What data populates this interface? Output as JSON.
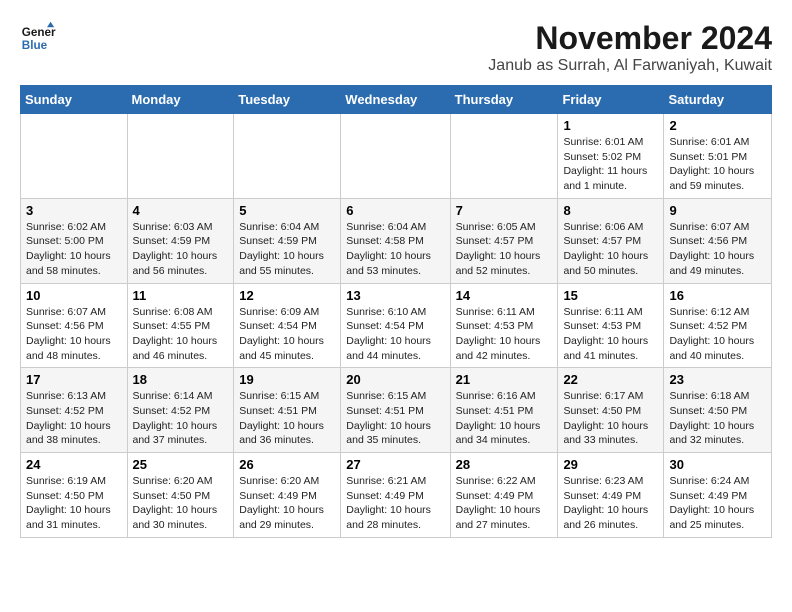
{
  "logo": {
    "line1": "General",
    "line2": "Blue"
  },
  "title": "November 2024",
  "location": "Janub as Surrah, Al Farwaniyah, Kuwait",
  "weekdays": [
    "Sunday",
    "Monday",
    "Tuesday",
    "Wednesday",
    "Thursday",
    "Friday",
    "Saturday"
  ],
  "weeks": [
    [
      {
        "day": "",
        "detail": ""
      },
      {
        "day": "",
        "detail": ""
      },
      {
        "day": "",
        "detail": ""
      },
      {
        "day": "",
        "detail": ""
      },
      {
        "day": "",
        "detail": ""
      },
      {
        "day": "1",
        "detail": "Sunrise: 6:01 AM\nSunset: 5:02 PM\nDaylight: 11 hours\nand 1 minute."
      },
      {
        "day": "2",
        "detail": "Sunrise: 6:01 AM\nSunset: 5:01 PM\nDaylight: 10 hours\nand 59 minutes."
      }
    ],
    [
      {
        "day": "3",
        "detail": "Sunrise: 6:02 AM\nSunset: 5:00 PM\nDaylight: 10 hours\nand 58 minutes."
      },
      {
        "day": "4",
        "detail": "Sunrise: 6:03 AM\nSunset: 4:59 PM\nDaylight: 10 hours\nand 56 minutes."
      },
      {
        "day": "5",
        "detail": "Sunrise: 6:04 AM\nSunset: 4:59 PM\nDaylight: 10 hours\nand 55 minutes."
      },
      {
        "day": "6",
        "detail": "Sunrise: 6:04 AM\nSunset: 4:58 PM\nDaylight: 10 hours\nand 53 minutes."
      },
      {
        "day": "7",
        "detail": "Sunrise: 6:05 AM\nSunset: 4:57 PM\nDaylight: 10 hours\nand 52 minutes."
      },
      {
        "day": "8",
        "detail": "Sunrise: 6:06 AM\nSunset: 4:57 PM\nDaylight: 10 hours\nand 50 minutes."
      },
      {
        "day": "9",
        "detail": "Sunrise: 6:07 AM\nSunset: 4:56 PM\nDaylight: 10 hours\nand 49 minutes."
      }
    ],
    [
      {
        "day": "10",
        "detail": "Sunrise: 6:07 AM\nSunset: 4:56 PM\nDaylight: 10 hours\nand 48 minutes."
      },
      {
        "day": "11",
        "detail": "Sunrise: 6:08 AM\nSunset: 4:55 PM\nDaylight: 10 hours\nand 46 minutes."
      },
      {
        "day": "12",
        "detail": "Sunrise: 6:09 AM\nSunset: 4:54 PM\nDaylight: 10 hours\nand 45 minutes."
      },
      {
        "day": "13",
        "detail": "Sunrise: 6:10 AM\nSunset: 4:54 PM\nDaylight: 10 hours\nand 44 minutes."
      },
      {
        "day": "14",
        "detail": "Sunrise: 6:11 AM\nSunset: 4:53 PM\nDaylight: 10 hours\nand 42 minutes."
      },
      {
        "day": "15",
        "detail": "Sunrise: 6:11 AM\nSunset: 4:53 PM\nDaylight: 10 hours\nand 41 minutes."
      },
      {
        "day": "16",
        "detail": "Sunrise: 6:12 AM\nSunset: 4:52 PM\nDaylight: 10 hours\nand 40 minutes."
      }
    ],
    [
      {
        "day": "17",
        "detail": "Sunrise: 6:13 AM\nSunset: 4:52 PM\nDaylight: 10 hours\nand 38 minutes."
      },
      {
        "day": "18",
        "detail": "Sunrise: 6:14 AM\nSunset: 4:52 PM\nDaylight: 10 hours\nand 37 minutes."
      },
      {
        "day": "19",
        "detail": "Sunrise: 6:15 AM\nSunset: 4:51 PM\nDaylight: 10 hours\nand 36 minutes."
      },
      {
        "day": "20",
        "detail": "Sunrise: 6:15 AM\nSunset: 4:51 PM\nDaylight: 10 hours\nand 35 minutes."
      },
      {
        "day": "21",
        "detail": "Sunrise: 6:16 AM\nSunset: 4:51 PM\nDaylight: 10 hours\nand 34 minutes."
      },
      {
        "day": "22",
        "detail": "Sunrise: 6:17 AM\nSunset: 4:50 PM\nDaylight: 10 hours\nand 33 minutes."
      },
      {
        "day": "23",
        "detail": "Sunrise: 6:18 AM\nSunset: 4:50 PM\nDaylight: 10 hours\nand 32 minutes."
      }
    ],
    [
      {
        "day": "24",
        "detail": "Sunrise: 6:19 AM\nSunset: 4:50 PM\nDaylight: 10 hours\nand 31 minutes."
      },
      {
        "day": "25",
        "detail": "Sunrise: 6:20 AM\nSunset: 4:50 PM\nDaylight: 10 hours\nand 30 minutes."
      },
      {
        "day": "26",
        "detail": "Sunrise: 6:20 AM\nSunset: 4:49 PM\nDaylight: 10 hours\nand 29 minutes."
      },
      {
        "day": "27",
        "detail": "Sunrise: 6:21 AM\nSunset: 4:49 PM\nDaylight: 10 hours\nand 28 minutes."
      },
      {
        "day": "28",
        "detail": "Sunrise: 6:22 AM\nSunset: 4:49 PM\nDaylight: 10 hours\nand 27 minutes."
      },
      {
        "day": "29",
        "detail": "Sunrise: 6:23 AM\nSunset: 4:49 PM\nDaylight: 10 hours\nand 26 minutes."
      },
      {
        "day": "30",
        "detail": "Sunrise: 6:24 AM\nSunset: 4:49 PM\nDaylight: 10 hours\nand 25 minutes."
      }
    ]
  ]
}
